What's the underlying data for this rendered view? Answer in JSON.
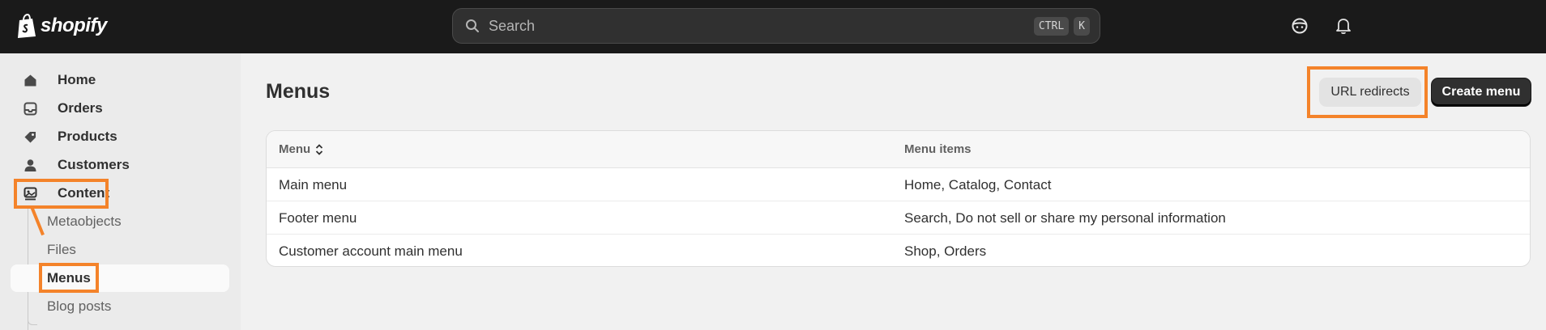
{
  "topbar": {
    "brand": "shopify",
    "search": {
      "placeholder": "Search",
      "shortcut_mod": "CTRL",
      "shortcut_key": "K"
    },
    "icons": [
      "store-assistant-icon",
      "bell-icon"
    ]
  },
  "sidebar": {
    "items": [
      {
        "label": "Home",
        "icon": "home-icon"
      },
      {
        "label": "Orders",
        "icon": "orders-icon"
      },
      {
        "label": "Products",
        "icon": "tag-icon"
      },
      {
        "label": "Customers",
        "icon": "person-icon"
      },
      {
        "label": "Content",
        "icon": "content-icon"
      }
    ],
    "content_sub": [
      {
        "label": "Metaobjects"
      },
      {
        "label": "Files"
      },
      {
        "label": "Menus",
        "active": true
      },
      {
        "label": "Blog posts"
      }
    ]
  },
  "main": {
    "title": "Menus",
    "buttons": {
      "secondary": "URL redirects",
      "primary": "Create menu"
    },
    "table": {
      "headers": [
        "Menu",
        "Menu items"
      ],
      "rows": [
        [
          "Main menu",
          "Home, Catalog, Contact"
        ],
        [
          "Footer menu",
          "Search, Do not sell or share my personal information"
        ],
        [
          "Customer account main menu",
          "Shop, Orders"
        ]
      ]
    }
  },
  "colors": {
    "topbar": "#1a1a1a",
    "accent_annotation": "#f4832a",
    "primary_button": "#303030"
  }
}
